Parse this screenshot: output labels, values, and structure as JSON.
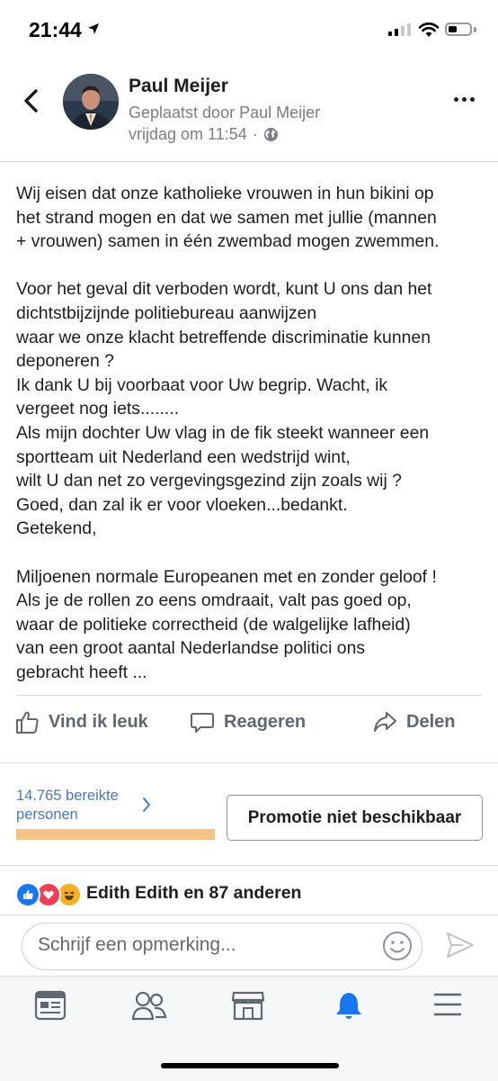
{
  "status_bar": {
    "time": "21:44"
  },
  "post": {
    "author": "Paul Meijer",
    "posted_by": "Geplaatst door Paul Meijer",
    "time": "vrijdag om 11:54",
    "privacy_separator": "·",
    "paragraphs": [
      [
        "Wij eisen dat onze katholieke vrouwen in hun bikini op",
        "het strand mogen en dat we samen met jullie (mannen",
        "+ vrouwen) samen in één zwembad mogen zwemmen."
      ],
      [
        "Voor het geval dit verboden wordt, kunt U ons dan het",
        "dichtstbijzijnde politiebureau aanwijzen",
        "waar we onze klacht betreffende discriminatie kunnen",
        "deponeren ?",
        "Ik dank U  bij  voorbaat  voor  Uw  begrip. Wacht, ik",
        "vergeet nog iets........",
        "Als mijn dochter Uw vlag in de fik steekt wanneer een",
        "sportteam uit Nederland een wedstrijd wint,",
        "wilt U dan net zo vergevingsgezind zijn zoals wij ?",
        "Goed, dan zal ik er voor vloeken...bedankt.",
        "Getekend,"
      ],
      [
        "Miljoenen normale Europeanen met en zonder geloof !",
        "Als je de rollen zo eens omdraait, valt pas goed op,",
        "waar de politieke correctheid (de walgelijke lafheid)",
        "van een groot aantal Nederlandse politici ons",
        "gebracht heeft ..."
      ]
    ]
  },
  "actions": {
    "like": "Vind ik leuk",
    "comment": "Reageren",
    "share": "Delen"
  },
  "insights": {
    "reach_line1": "14.765 bereikte",
    "reach_line2": "personen",
    "promote_button": "Promotie niet beschikbaar"
  },
  "reactions": {
    "summary": "Edith Edith en 87 anderen",
    "types": [
      "like",
      "love",
      "haha"
    ]
  },
  "comment": {
    "placeholder": "Schrijf een opmerking..."
  },
  "tabbar": [
    "news-feed",
    "friends",
    "marketplace",
    "notifications",
    "menu"
  ],
  "colors": {
    "fb_blue": "#1877f2",
    "love_red": "#f33e58",
    "haha_yellow": "#f7b125",
    "reach_bar": "#f7c28a",
    "link_blue": "#4a78c9"
  }
}
